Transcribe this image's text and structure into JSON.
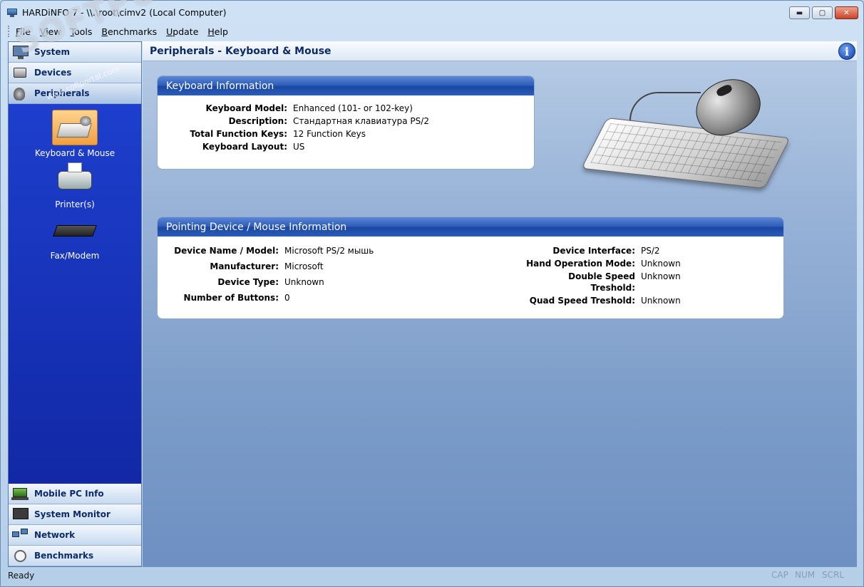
{
  "window": {
    "title": "HARDiNFO 7 - \\\\.\\root\\cimv2 (Local Computer)",
    "buttons": {
      "minimize": "▬",
      "maximize": "▢",
      "close": "✕"
    }
  },
  "menu": [
    "File",
    "View",
    "Tools",
    "Benchmarks",
    "Update",
    "Help"
  ],
  "sidebar": {
    "top_categories": [
      "System",
      "Devices",
      "Peripherals"
    ],
    "sub_items": [
      "Keyboard & Mouse",
      "Printer(s)",
      "Fax/Modem"
    ],
    "bottom_categories": [
      "Mobile PC Info",
      "System Monitor",
      "Network",
      "Benchmarks"
    ]
  },
  "content": {
    "title": "Peripherals - Keyboard & Mouse",
    "info_icon": "i",
    "keyboard_panel": {
      "title": "Keyboard Information",
      "rows": [
        {
          "key": "Keyboard Model:",
          "value": "Enhanced (101- or 102-key)"
        },
        {
          "key": "Description:",
          "value": "Стандартная клавиатура PS/2"
        },
        {
          "key": "Total Function Keys:",
          "value": "12 Function Keys"
        },
        {
          "key": "Keyboard Layout:",
          "value": "US"
        }
      ]
    },
    "mouse_panel": {
      "title": "Pointing Device / Mouse Information",
      "left_rows": [
        {
          "key": "Device Name / Model:",
          "value": "Microsoft PS/2 мышь"
        },
        {
          "key": "Manufacturer:",
          "value": "Microsoft"
        },
        {
          "key": "Device Type:",
          "value": "Unknown"
        },
        {
          "key": "Number of Buttons:",
          "value": "0"
        }
      ],
      "right_rows": [
        {
          "key": "Device Interface:",
          "value": "PS/2"
        },
        {
          "key": "Hand Operation Mode:",
          "value": "Unknown"
        },
        {
          "key": "Double Speed Treshold:",
          "value": "Unknown"
        },
        {
          "key": "Quad Speed Treshold:",
          "value": "Unknown"
        }
      ]
    }
  },
  "status": {
    "text": "Ready",
    "indicators": [
      "CAP",
      "NUM",
      "SCRL"
    ]
  },
  "watermark": {
    "brand": "SOFTPORTAL",
    "url": "www.softportal.com"
  }
}
